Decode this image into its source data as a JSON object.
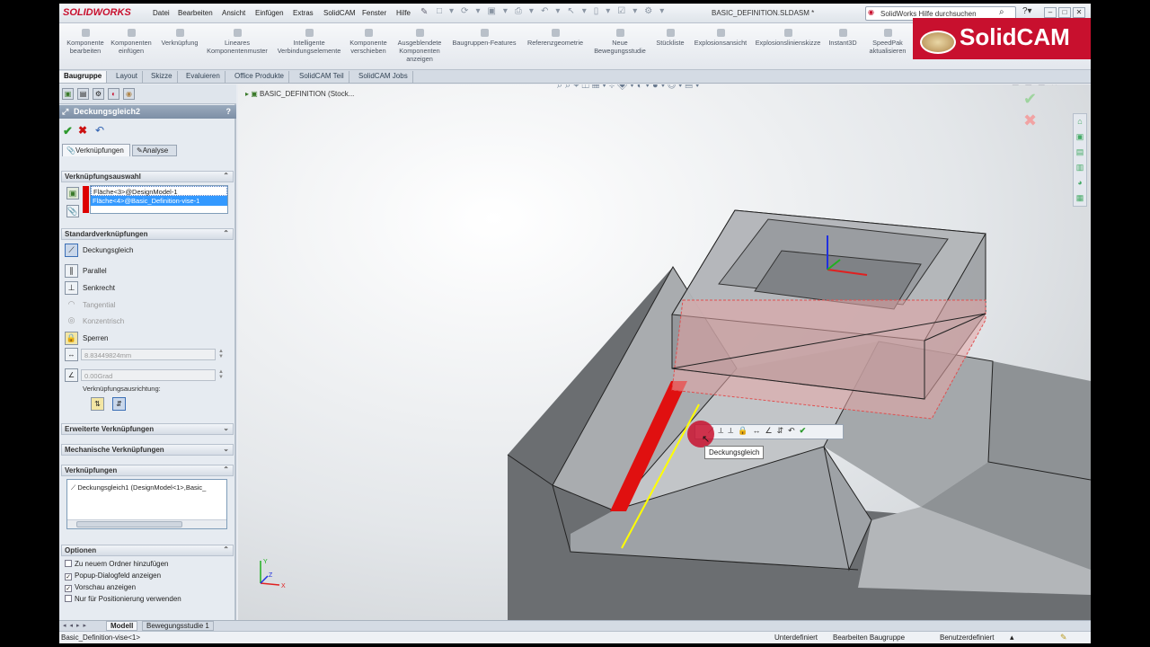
{
  "app": {
    "brand": "SOLIDWORKS",
    "doc_title": "BASIC_DEFINITION.SLDASM *",
    "help_placeholder": "SolidWorks Hilfe durchsuchen"
  },
  "menu": [
    "Datei",
    "Bearbeiten",
    "Ansicht",
    "Einfügen",
    "Extras",
    "SolidCAM",
    "Fenster",
    "Hilfe"
  ],
  "commands": [
    {
      "l1": "Komponente",
      "l2": "bearbeiten",
      "l3": ""
    },
    {
      "l1": "Komponenten",
      "l2": "einfügen",
      "l3": ""
    },
    {
      "l1": "Verknüpfung",
      "l2": "",
      "l3": ""
    },
    {
      "l1": "Lineares",
      "l2": "Komponentenmuster",
      "l3": ""
    },
    {
      "l1": "Intelligente",
      "l2": "Verbindungselemente",
      "l3": ""
    },
    {
      "l1": "Komponente",
      "l2": "verschieben",
      "l3": ""
    },
    {
      "l1": "Ausgeblendete",
      "l2": "Komponenten",
      "l3": "anzeigen"
    },
    {
      "l1": "Baugruppen-Features",
      "l2": "",
      "l3": ""
    },
    {
      "l1": "Referenzgeometrie",
      "l2": "",
      "l3": ""
    },
    {
      "l1": "Neue",
      "l2": "Bewegungsstudie",
      "l3": ""
    },
    {
      "l1": "Stückliste",
      "l2": "",
      "l3": ""
    },
    {
      "l1": "Explosionsansicht",
      "l2": "",
      "l3": ""
    },
    {
      "l1": "Explosionslinienskizze",
      "l2": "",
      "l3": ""
    },
    {
      "l1": "Instant3D",
      "l2": "",
      "l3": ""
    },
    {
      "l1": "SpeedPak",
      "l2": "aktualisieren",
      "l3": ""
    }
  ],
  "solidcam_logo": "SolidCAM",
  "tabs": [
    "Baugruppe",
    "Layout",
    "Skizze",
    "Evaluieren",
    "Office Produkte",
    "SolidCAM Teil",
    "SolidCAM Jobs"
  ],
  "panel": {
    "title": "Deckungsgleich2",
    "help": "?",
    "subtab_mates": "Verknüpfungen",
    "subtab_analysis": "Analyse",
    "sec_selection": "Verknüpfungsauswahl",
    "selections": [
      "Fläche<3>@DesignModel-1",
      "Fläche<4>@Basic_Definition-vise-1"
    ],
    "sec_standard": "Standardverknüpfungen",
    "mates": [
      {
        "label": "Deckungsgleich",
        "enabled": true
      },
      {
        "label": "Parallel",
        "enabled": true
      },
      {
        "label": "Senkrecht",
        "enabled": true
      },
      {
        "label": "Tangential",
        "enabled": false
      },
      {
        "label": "Konzentrisch",
        "enabled": false
      },
      {
        "label": "Sperren",
        "enabled": true
      }
    ],
    "distance_value": "8.83449824mm",
    "angle_value": "0.00Grad",
    "alignment_label": "Verknüpfungsausrichtung:",
    "sec_advanced": "Erweiterte Verknüpfungen",
    "sec_mechanical": "Mechanische Verknüpfungen",
    "sec_mates": "Verknüpfungen",
    "mate_list_item": "Deckungsgleich1 (DesignModel<1>,Basic_",
    "sec_options": "Optionen",
    "options": [
      {
        "label": "Zu neuem Ordner hinzufügen",
        "checked": false
      },
      {
        "label": "Popup-Dialogfeld anzeigen",
        "checked": true
      },
      {
        "label": "Vorschau anzeigen",
        "checked": true
      },
      {
        "label": "Nur für Positionierung verwenden",
        "checked": false
      }
    ]
  },
  "viewport": {
    "tree_root": "BASIC_DEFINITION  (Stock...",
    "tooltip": "Deckungsgleich",
    "axis_x": "X",
    "axis_y": "Y",
    "axis_z": "Z"
  },
  "bottom_tabs": [
    "Modell",
    "Bewegungsstudie 1"
  ],
  "status": {
    "left": "Basic_Definition-vise<1>",
    "s1": "Unterdefiniert",
    "s2": "Bearbeiten Baugruppe",
    "s3": "Benutzerdefiniert"
  },
  "colors": {
    "accent": "#c8102e",
    "selection": "#d00000",
    "edge_highlight": "#ffff00"
  }
}
